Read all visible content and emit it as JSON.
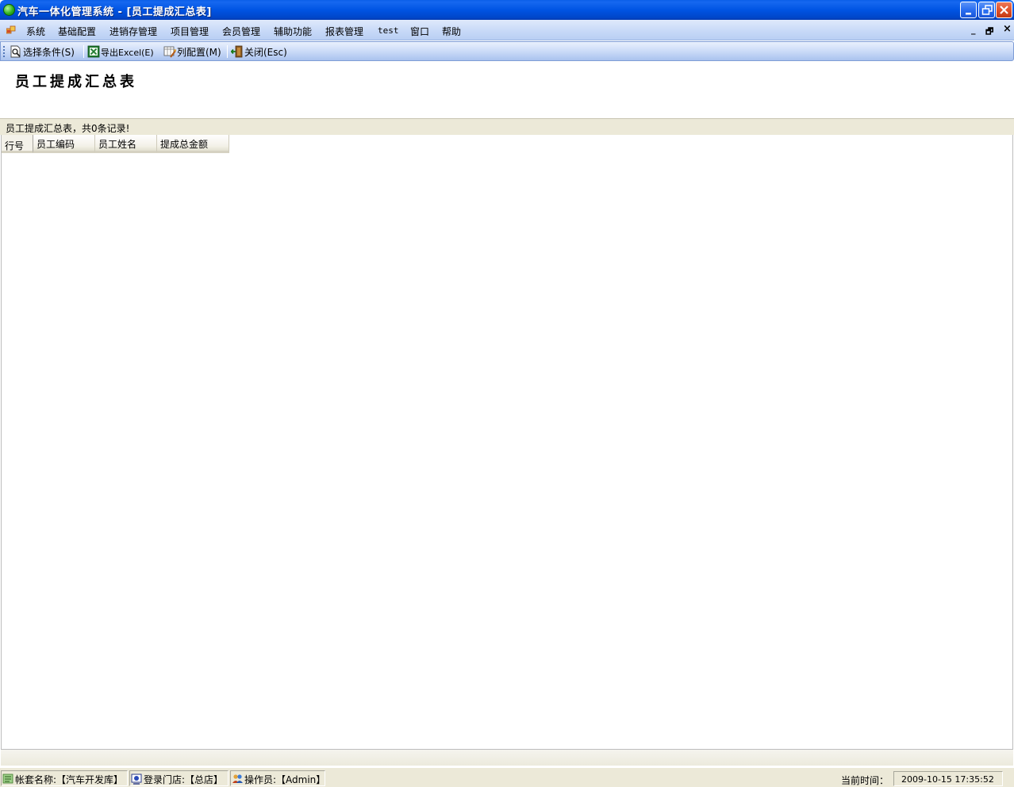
{
  "window": {
    "title": "汽车一体化管理系统 - [员工提成汇总表]",
    "icon": "app-globe-icon"
  },
  "menu": {
    "items": [
      "系统",
      "基础配置",
      "进销存管理",
      "项目管理",
      "会员管理",
      "辅助功能",
      "报表管理",
      "test",
      "窗口",
      "帮助"
    ],
    "mdi_minimize": "_",
    "mdi_restore": "🗗",
    "mdi_close": "×"
  },
  "toolbar": {
    "select_conditions": "选择条件(S)",
    "export_excel": "导出Excel(E)",
    "column_config": "列配置(M)",
    "close": "关闭(Esc)"
  },
  "report": {
    "title": "员工提成汇总表",
    "summary": "员工提成汇总表，共0条记录!"
  },
  "grid": {
    "columns": [
      "行号",
      "员工编码",
      "员工姓名",
      "提成总金额"
    ],
    "rows": []
  },
  "status": {
    "account": "帐套名称:【汽车开发库】",
    "store": "登录门店:【总店】",
    "operator": "操作员:【Admin】",
    "time_label": "当前时间：",
    "time_value": "2009-10-15 17:35:52"
  },
  "colors": {
    "titlebar": "#0054e3",
    "menubar": "#c6d8f7",
    "toolbar": "#c8d9f7",
    "status": "#ece9d8"
  }
}
